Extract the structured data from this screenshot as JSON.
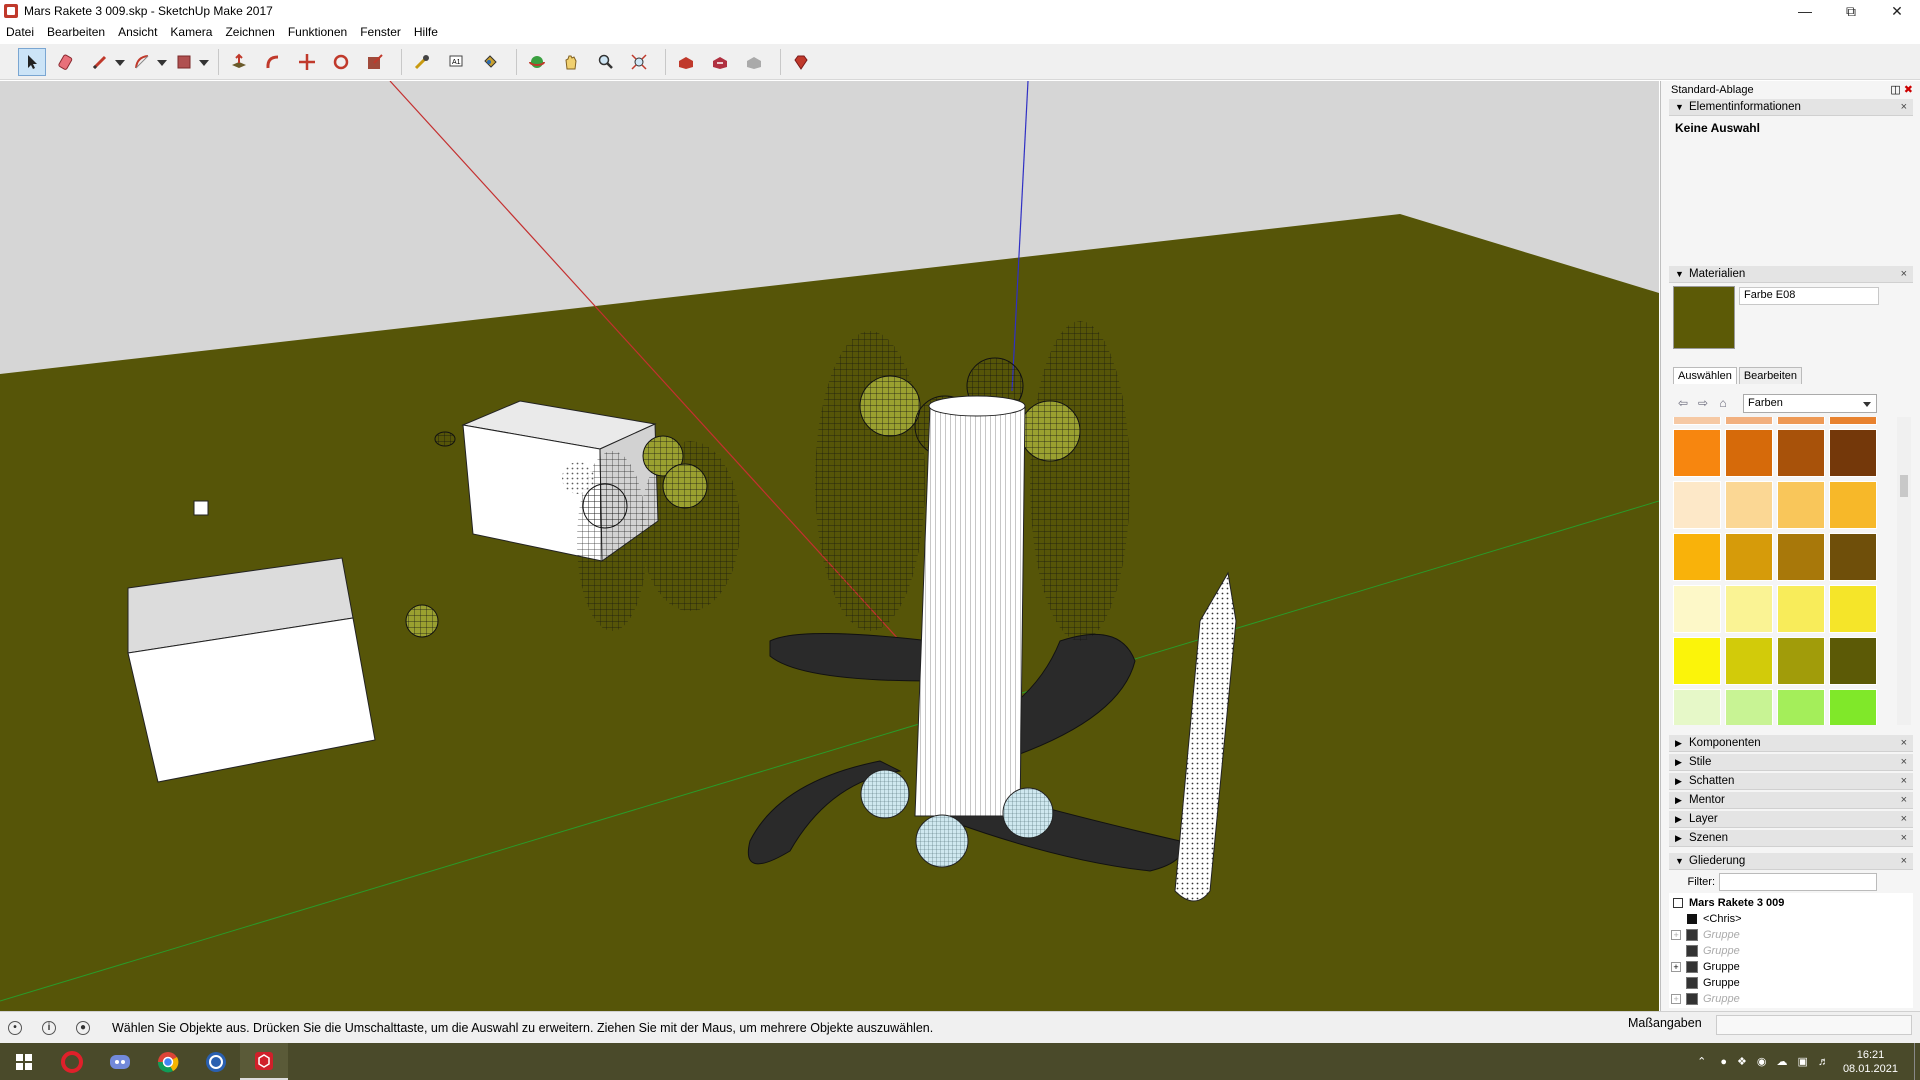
{
  "window": {
    "title": "Mars Rakete 3 009.skp - SketchUp Make 2017",
    "controls": [
      "minimize",
      "restore",
      "close"
    ]
  },
  "menu": [
    "Datei",
    "Bearbeiten",
    "Ansicht",
    "Kamera",
    "Zeichnen",
    "Funktionen",
    "Fenster",
    "Hilfe"
  ],
  "toolbar": {
    "tools": [
      {
        "name": "select-tool",
        "icon": "arrow-cursor-icon",
        "active": true
      },
      {
        "name": "eraser-tool",
        "icon": "eraser-icon"
      },
      {
        "name": "line-tool",
        "icon": "pencil-icon",
        "dropdown": true
      },
      {
        "name": "arc-tool",
        "icon": "arc-icon",
        "dropdown": true
      },
      {
        "name": "rectangle-tool",
        "icon": "rectangle-icon",
        "dropdown": true
      },
      {
        "name": "push-pull-tool",
        "icon": "push-pull-icon"
      },
      {
        "name": "follow-me-tool",
        "icon": "follow-me-icon"
      },
      {
        "name": "move-tool",
        "icon": "move-icon"
      },
      {
        "name": "rotate-tool",
        "icon": "rotate-icon"
      },
      {
        "name": "scale-tool",
        "icon": "scale-icon"
      },
      {
        "name": "tape-measure-tool",
        "icon": "tape-measure-icon"
      },
      {
        "name": "text-tool",
        "icon": "text-icon"
      },
      {
        "name": "paint-bucket-tool",
        "icon": "paint-bucket-icon"
      },
      {
        "name": "orbit-tool",
        "icon": "orbit-icon"
      },
      {
        "name": "pan-tool",
        "icon": "hand-icon"
      },
      {
        "name": "zoom-tool",
        "icon": "zoom-icon"
      },
      {
        "name": "zoom-extents-tool",
        "icon": "zoom-extents-icon"
      },
      {
        "name": "warehouse-tool",
        "icon": "warehouse-icon"
      },
      {
        "name": "share-model-tool",
        "icon": "share-model-icon"
      },
      {
        "name": "extension-warehouse-tool",
        "icon": "extension-warehouse-icon"
      },
      {
        "name": "ruby-tool",
        "icon": "ruby-icon"
      }
    ]
  },
  "tray": {
    "title": "Standard-Ablage",
    "element_info": {
      "header": "Elementinformationen",
      "selection": "Keine Auswahl"
    },
    "materials": {
      "header": "Materialien",
      "current_name": "Farbe E08",
      "current_color": "#5c5a06",
      "tab_select": "Auswählen",
      "tab_edit": "Bearbeiten",
      "library": "Farben",
      "swatches": [
        "#f6c9a4",
        "#f2b07f",
        "#ee9955",
        "#e8822f",
        "#f7860f",
        "#d66a0a",
        "#a8520a",
        "#74380a",
        "#fde8c8",
        "#fbd794",
        "#f9c65a",
        "#f7b829",
        "#f9b20a",
        "#d69b0a",
        "#a8780a",
        "#6f4f0a",
        "#fdf8c8",
        "#faf394",
        "#f8ec5a",
        "#f5e529",
        "#fbf40a",
        "#d2cb0a",
        "#a19c0a",
        "#5c5a06",
        "#e6f8c8",
        "#c8f394",
        "#a4ee5a",
        "#80e829"
      ]
    },
    "collapsed_sections": [
      "Komponenten",
      "Stile",
      "Schatten",
      "Mentor",
      "Layer",
      "Szenen"
    ],
    "outliner": {
      "header": "Gliederung",
      "filter_label": "Filter:",
      "filter_value": "",
      "root": "Mars Rakete 3 009",
      "items": [
        {
          "label": "<Chris>",
          "hidden": false,
          "expand": false
        },
        {
          "label": "Gruppe",
          "hidden": true,
          "expand": true
        },
        {
          "label": "Gruppe",
          "hidden": true,
          "expand": false
        },
        {
          "label": "Gruppe",
          "hidden": false,
          "expand": true
        },
        {
          "label": "Gruppe",
          "hidden": false,
          "expand": false
        },
        {
          "label": "Gruppe",
          "hidden": true,
          "expand": true
        }
      ]
    }
  },
  "status": {
    "message": "Wählen Sie Objekte aus. Drücken Sie die Umschalttaste, um die Auswahl zu erweitern. Ziehen Sie mit der Maus, um mehrere Objekte auszuwählen.",
    "measure_label": "Maßangaben",
    "measure_value": ""
  },
  "taskbar": {
    "apps": [
      "windows-start-icon",
      "opera-icon",
      "discord-icon",
      "chrome-icon",
      "blue-app-icon",
      "sketchup-icon"
    ],
    "time": "16:21",
    "date": "08.01.2021"
  },
  "colors": {
    "ground": "#565508",
    "sky": "#d6d6d6",
    "taskbar": "#4a4a2a"
  }
}
